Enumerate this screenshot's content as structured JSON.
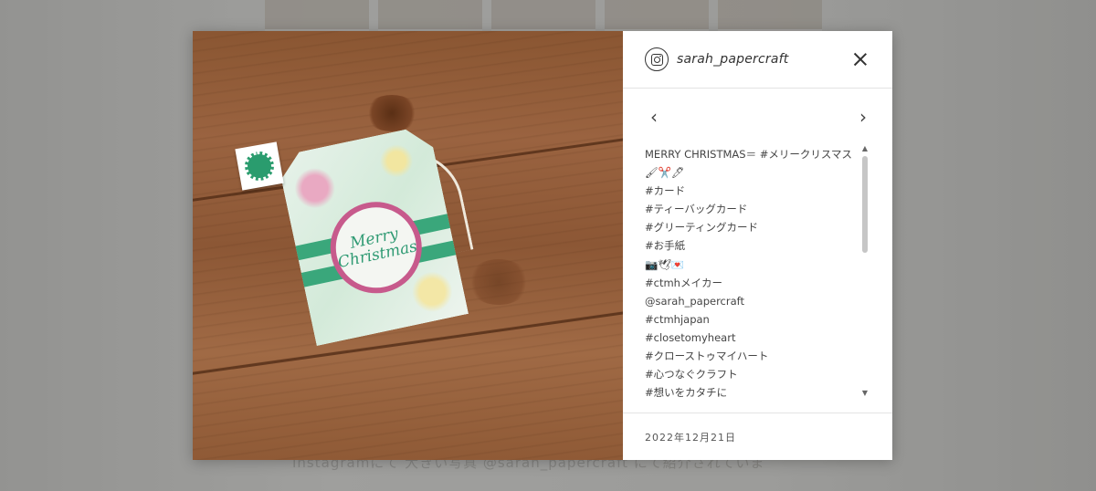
{
  "background": {
    "caption": "Instagramにて 大きい写真 @sarah_papercraft にて紹介されていま"
  },
  "post_image": {
    "alt": "Merry Christmas tea bag card on a wooden table",
    "card_text_line1": "Merry",
    "card_text_line2": "Christmas"
  },
  "header": {
    "username": "sarah_papercraft",
    "instagram_icon": "instagram-icon",
    "close_icon": "close-icon"
  },
  "nav": {
    "prev_icon": "chevron-left-icon",
    "next_icon": "chevron-right-icon",
    "prev_glyph": "‹",
    "next_glyph": "›"
  },
  "caption": {
    "lines": [
      "MERRY CHRISTMAS＝ #メリークリスマス",
      "🖌✂️🖊",
      "#カード",
      "#ティーバッグカード",
      "#グリーティングカード",
      "#お手紙",
      "📷🕊💌",
      "#ctmhメイカー",
      "@sarah_papercraft",
      "#ctmhjapan",
      "#closetomyheart",
      "#クローストゥマイハート",
      "#心つなぐクラフト",
      "#想いをカタチに"
    ],
    "scroll_up_glyph": "▲",
    "scroll_down_glyph": "▼"
  },
  "footer": {
    "date": "2022年12月21日"
  },
  "colors": {
    "overlay": "#464646",
    "accent_green": "#2f9a73",
    "accent_pink": "#c75a8c",
    "wood": "#8f5a36"
  }
}
